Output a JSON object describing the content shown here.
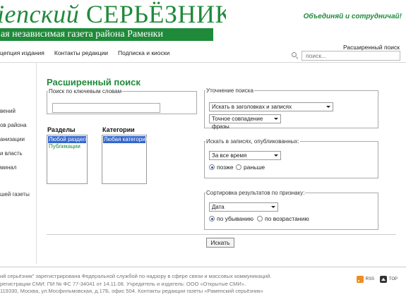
{
  "header": {
    "logo_word1": "ienский",
    "logo_word2": "СЕРЬЁЗНИК",
    "logo_subtitle": "ая независимая газета района Раменки",
    "slogan": "Объединяй и сотрудничай!"
  },
  "topnav": {
    "items": [
      "цепция издания",
      "Контакты редакции",
      "Подписка и киоски"
    ],
    "advanced_search_link": "Расширенный поиск"
  },
  "search": {
    "placeholder": "поиск..."
  },
  "sidebar": {
    "items": [
      "вений",
      "ов района",
      "анизации",
      "и власть",
      "минал",
      "шей газеты"
    ]
  },
  "main": {
    "title": "Расширенный поиск",
    "keywords_legend": "Поиск по ключевым словам",
    "sections_label": "Разделы",
    "sections_options": [
      "Любой раздел",
      "Публикации"
    ],
    "categories_label": "Категории",
    "categories_options": [
      "Любая категория"
    ],
    "refine_legend": "Уточнение поиска",
    "refine_scope": "Искать в заголовках и записях",
    "refine_match": "Точное совпадение фразы",
    "date_legend": "Искать в записях, опубликованных:",
    "date_range": "За все время",
    "date_later": "позже",
    "date_earlier": "раньше",
    "sort_legend": "Сортировка результатов по признаку:",
    "sort_field": "Дата",
    "sort_desc": "по убыванию",
    "sort_asc": "по возрастанию",
    "submit_label": "Искать"
  },
  "footer": {
    "line1": "ий серьёзник\" зарегистрирована Федеральной службой по надзору в сфере связи и массовых коммуникаций.",
    "line2": "регистрации СМИ: ПИ № ФС 77-34041 от 14.11.08. Учредитель и издатель: ООО «Открытые СМИ».",
    "line3": "119330, Москва, ул.Мосфильмовская, д.17Б, офис 504. Контакты редакции газеты «Раменский серьёзник»",
    "rss_label": "RSS",
    "top_label": "TOP"
  },
  "colors": {
    "brand_green": "#1f8a3a",
    "selection_blue": "#3366cc"
  },
  "icons": [
    "search-icon",
    "rss-icon",
    "top-arrow-icon"
  ]
}
